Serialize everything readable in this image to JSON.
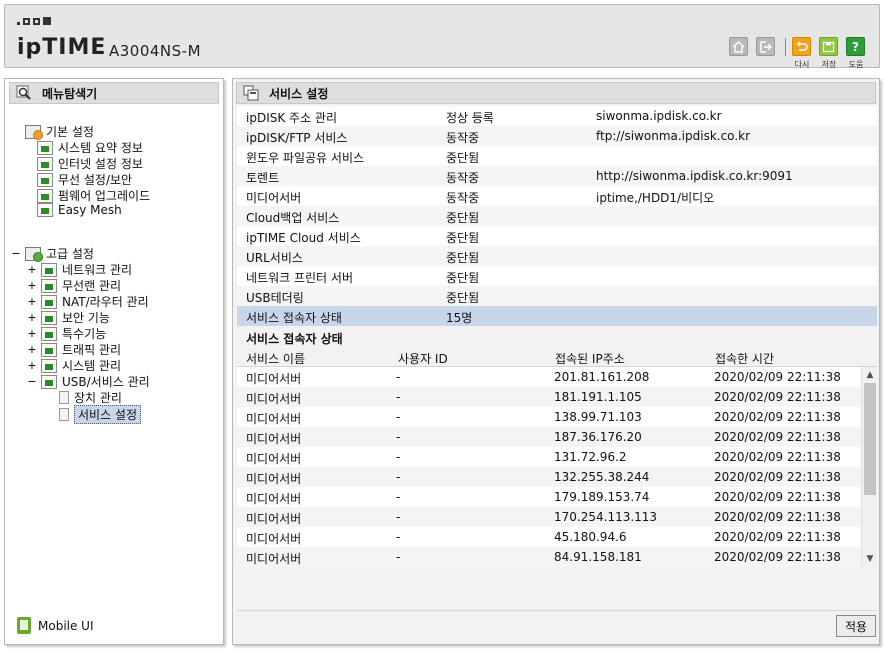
{
  "header": {
    "brand": "ipTIME",
    "model": "A3004NS-M",
    "buttons": [
      {
        "label": "",
        "icon": "home-icon"
      },
      {
        "label": "",
        "icon": "logout-icon"
      },
      {
        "label": "다시",
        "icon": "undo-icon"
      },
      {
        "label": "저장",
        "icon": "save-icon"
      },
      {
        "label": "도움",
        "icon": "help-icon"
      }
    ]
  },
  "left_panel": {
    "title": "메뉴탐색기",
    "basic": {
      "label": "기본 설정",
      "items": [
        "시스템 요약 정보",
        "인터넷 설정 정보",
        "무선 설정/보안",
        "펌웨어 업그레이드",
        "Easy Mesh"
      ]
    },
    "advanced": {
      "label": "고급 설정",
      "items": [
        "네트워크 관리",
        "무선랜 관리",
        "NAT/라우터 관리",
        "보안 기능",
        "특수기능",
        "트래픽 관리",
        "시스템 관리",
        "USB/서비스 관리"
      ],
      "usb_children": [
        "장치 관리",
        "서비스 설정"
      ]
    },
    "mobile_label": "Mobile UI"
  },
  "right_panel": {
    "title": "서비스 설정",
    "services": [
      {
        "name": "ipDISK 주소 관리",
        "status": "정상 등록",
        "info": "siwonma.ipdisk.co.kr"
      },
      {
        "name": "ipDISK/FTP 서비스",
        "status": "동작중",
        "info": "ftp://siwonma.ipdisk.co.kr"
      },
      {
        "name": "윈도우 파일공유 서비스",
        "status": "중단됨",
        "info": ""
      },
      {
        "name": "토렌트",
        "status": "동작중",
        "info": "http://siwonma.ipdisk.co.kr:9091"
      },
      {
        "name": "미디어서버",
        "status": "동작중",
        "info": "iptime,/HDD1/비디오"
      },
      {
        "name": "Cloud백업 서비스",
        "status": "중단됨",
        "info": ""
      },
      {
        "name": "ipTIME Cloud 서비스",
        "status": "중단됨",
        "info": ""
      },
      {
        "name": "URL서비스",
        "status": "중단됨",
        "info": ""
      },
      {
        "name": "네트워크 프린터 서버",
        "status": "중단됨",
        "info": ""
      },
      {
        "name": "USB테더링",
        "status": "중단됨",
        "info": ""
      },
      {
        "name": "서비스 접속자 상태",
        "status": "15명",
        "info": ""
      }
    ],
    "users_title": "서비스 접속자 상태",
    "users_headers": [
      "서비스 이름",
      "사용자 ID",
      "접속된 IP주소",
      "접속한 시간"
    ],
    "users": [
      {
        "service": "미디어서버",
        "user": "-",
        "ip": "201.81.161.208",
        "time": "2020/02/09 22:11:38"
      },
      {
        "service": "미디어서버",
        "user": "-",
        "ip": "181.191.1.105",
        "time": "2020/02/09 22:11:38"
      },
      {
        "service": "미디어서버",
        "user": "-",
        "ip": "138.99.71.103",
        "time": "2020/02/09 22:11:38"
      },
      {
        "service": "미디어서버",
        "user": "-",
        "ip": "187.36.176.20",
        "time": "2020/02/09 22:11:38"
      },
      {
        "service": "미디어서버",
        "user": "-",
        "ip": "131.72.96.2",
        "time": "2020/02/09 22:11:38"
      },
      {
        "service": "미디어서버",
        "user": "-",
        "ip": "132.255.38.244",
        "time": "2020/02/09 22:11:38"
      },
      {
        "service": "미디어서버",
        "user": "-",
        "ip": "179.189.153.74",
        "time": "2020/02/09 22:11:38"
      },
      {
        "service": "미디어서버",
        "user": "-",
        "ip": "170.254.113.113",
        "time": "2020/02/09 22:11:38"
      },
      {
        "service": "미디어서버",
        "user": "-",
        "ip": "45.180.94.6",
        "time": "2020/02/09 22:11:38"
      },
      {
        "service": "미디어서버",
        "user": "-",
        "ip": "84.91.158.181",
        "time": "2020/02/09 22:11:38"
      }
    ],
    "apply_label": "적용"
  }
}
